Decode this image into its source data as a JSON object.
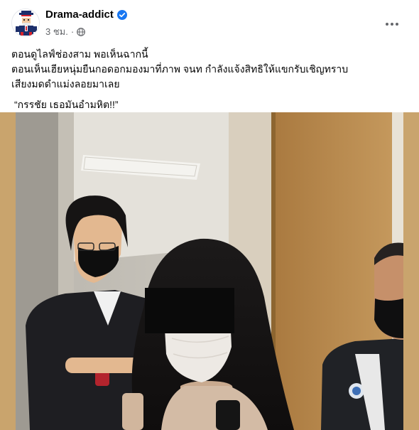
{
  "post": {
    "page_name": "Drama-addict",
    "time": "3 ชม.",
    "separator": "·",
    "lines": [
      "ตอนดูไลฟ์ช่องสาม พอเห็นฉากนี้",
      "ตอนเห็นเฮียหนุ่มยืนกอดอกมองมาที่ภาพ จนท กำลังแจ้งสิทธิให้แขกรับเชิญทราบ",
      "เสียงมดดำแม่งลอยมาเลย"
    ],
    "quote": "“กรรชัย เธอมันอำมหิต!!”"
  },
  "icons": {
    "verified": "verified-badge-icon",
    "privacy": "globe-icon",
    "more": "more-options-icon"
  },
  "colors": {
    "verified_blue": "#1877f2",
    "meta_gray": "#65676b",
    "censor_black": "#0a0a0a",
    "photo_backdrop": "#c9a46d"
  }
}
